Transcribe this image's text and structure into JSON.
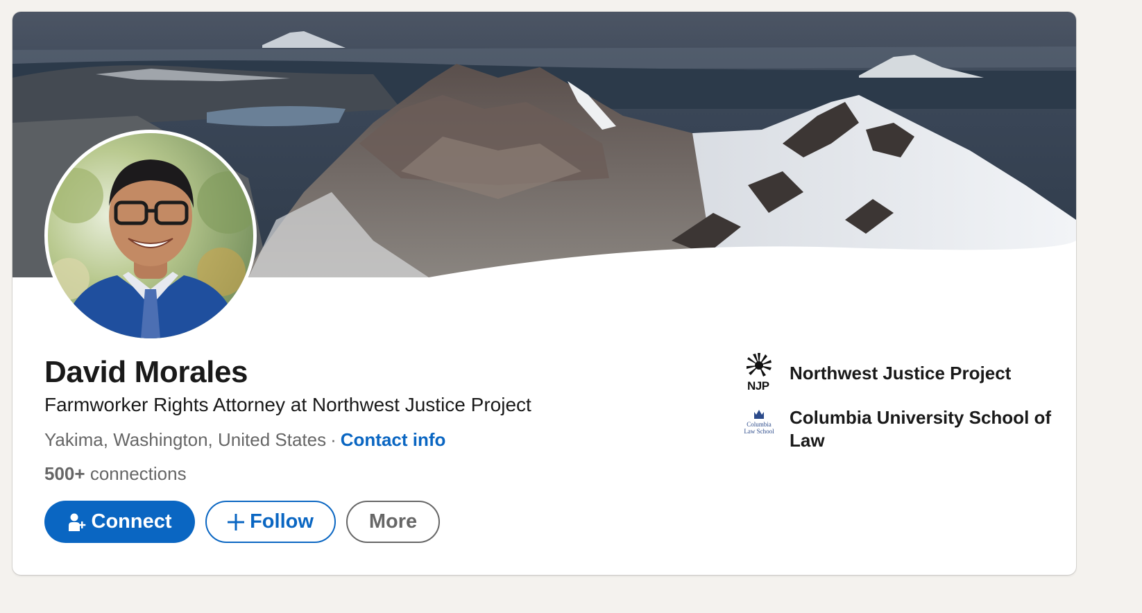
{
  "profile": {
    "name": "David Morales",
    "headline": "Farmworker Rights Attorney at Northwest Justice Project",
    "location": "Yakima, Washington, United States",
    "separator": "·",
    "contact_info_label": "Contact info",
    "connections_count": "500+",
    "connections_label": "connections"
  },
  "actions": {
    "connect_label": "Connect",
    "follow_label": "Follow",
    "more_label": "More"
  },
  "organizations": [
    {
      "name": "Northwest Justice Project",
      "logo_text": "NJP"
    },
    {
      "name": "Columbia University School of Law",
      "logo_text_line1": "Columbia",
      "logo_text_line2": "Law School"
    }
  ],
  "colors": {
    "accent": "#0a66c2",
    "text_primary": "#191919",
    "text_secondary": "#666666",
    "page_background": "#f4f2ee"
  },
  "icons": {
    "connect": "add-person-icon",
    "follow": "plus-icon"
  }
}
